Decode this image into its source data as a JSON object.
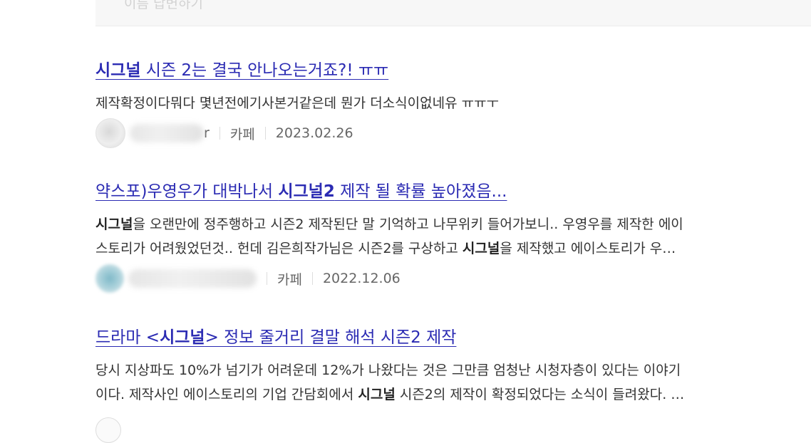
{
  "top_panel": {
    "ghost_text": "이름        답변하기"
  },
  "results": [
    {
      "title_bold": "시그널",
      "title_rest": " 시즌 2는 결국 안나오는거죠?! ㅠㅠ",
      "snippet_line1": "제작확정이다뭐다 몇년전에기사본거같은데 뭔가 더소식이없네유 ㅠㅠㅜ",
      "author_visible_tail": "r",
      "source": "카페",
      "date": "2023.02.26"
    },
    {
      "title_pre": "약스포)우영우가 대박나서 ",
      "title_bold": "시그널2",
      "title_rest": " 제작 될 확률 높아졌음...",
      "snippet_line1_bold": "시그널",
      "snippet_line1_rest": "을 오랜만에 정주행하고 시즌2 제작된단 말 기억하고 나무위키 들어가보니.. 우영우를 제작한 에이",
      "snippet_line2_pre": "스토리가 어려웠었던것.. 헌데 김은희작가님은 시즌2를 구상하고 ",
      "snippet_line2_bold": "시그널",
      "snippet_line2_rest": "을 제작했고 에이스토리가 우…",
      "source": "카페",
      "date": "2022.12.06"
    },
    {
      "title_pre": "드라마 <",
      "title_bold": "시그널",
      "title_rest": "> 정보 줄거리 결말 해석 시즌2 제작",
      "snippet_line1": "당시 지상파도 10%가 넘기가 어려운데 12%가 나왔다는 것은 그만큼 엄청난 시청자층이 있다는 이야기",
      "snippet_line2_pre": "이다. 제작사인 에이스토리의 기업 간담회에서 ",
      "snippet_line2_bold": "시그널",
      "snippet_line2_rest": " 시즌2의 제작이 확정되었다는 소식이 들려왔다. …"
    }
  ],
  "icons": {
    "avatar_1": "profile-avatar",
    "avatar_2": "profile-avatar",
    "avatar_3": "profile-avatar"
  },
  "colors": {
    "link": "#2b2bb3",
    "text": "#333333",
    "meta": "#666666",
    "separator": "#dddddd"
  }
}
